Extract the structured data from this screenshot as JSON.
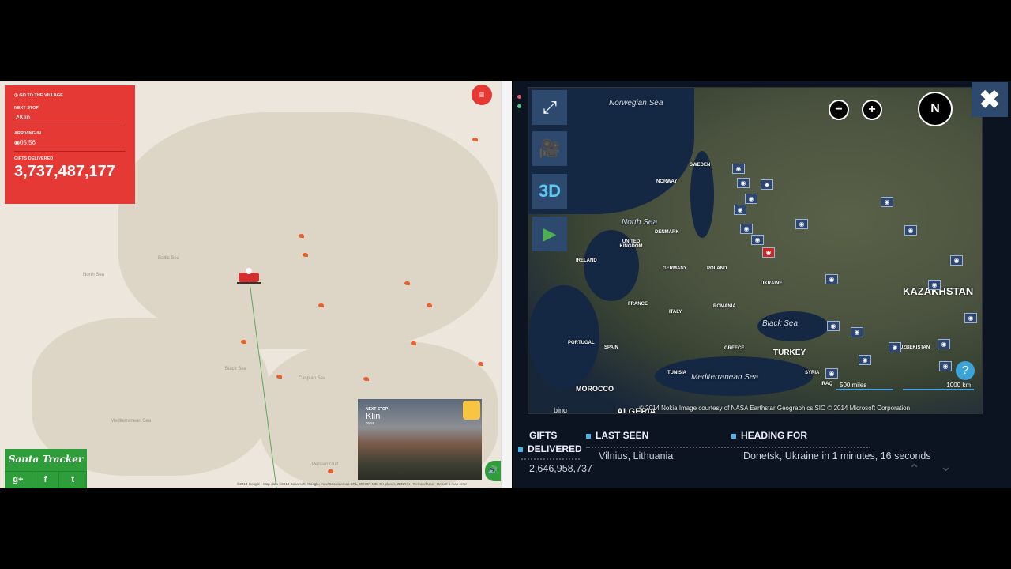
{
  "left_tracker": {
    "go_to_village": "GO TO THE VILLAGE",
    "next_stop_label": "NEXT STOP",
    "next_stop": "Klin",
    "arriving_label": "ARRIVING IN",
    "arriving_in": "05:56",
    "gifts_label": "GIFTS DELIVERED",
    "gifts_delivered": "3,737,487,177",
    "menu_icon": "≡",
    "map_labels": [
      "Baltic Sea",
      "North Sea",
      "Black Sea",
      "Caspian Sea",
      "Mediterranean Sea",
      "Persian Gulf"
    ],
    "brand": "Santa Tracker",
    "social": [
      "g+",
      "f",
      "t"
    ],
    "card": {
      "label": "NEXT STOP",
      "city": "Klin",
      "time": "05:55"
    },
    "attribution": "©2014 Google - Map data ©2014 Basarsoft, Google, Inav/Geosistemas SRL, ORION-ME, SK planet, ZENRIN",
    "terms": "Terms of Use",
    "report": "Report a map error",
    "accent_color": "#e53935",
    "green_color": "#2e9e3a"
  },
  "right_tracker": {
    "sea_labels": [
      "Norwegian Sea",
      "North Sea",
      "Black Sea",
      "Mediterranean Sea"
    ],
    "country_labels": [
      "SWEDEN",
      "NORWAY",
      "DENMARK",
      "UNITED KINGDOM",
      "IRELAND",
      "GERMANY",
      "POLAND",
      "UKRAINE",
      "FRANCE",
      "ROMANIA",
      "ITALY",
      "SPAIN",
      "PORTUGAL",
      "GREECE",
      "TURKEY",
      "TUNISIA",
      "SYRIA",
      "MOROCCO",
      "ALGERIA",
      "KAZAKHSTAN",
      "UZBEKISTAN",
      "IRAQ"
    ],
    "tool_3d": "3D",
    "compass": "N",
    "zoom_out": "−",
    "zoom_in": "+",
    "help": "?",
    "close": "✖",
    "scale_miles": "500 miles",
    "scale_km": "1000 km",
    "bing": "bing",
    "attribution": "© 2014 Nokia   Image courtesy of NASA   Earthstar Geographics SIO   © 2014 Microsoft Corporation",
    "gifts_label_1": "GIFTS",
    "gifts_label_2": "DELIVERED",
    "gifts_delivered": "2,646,958,737",
    "last_seen_label": "LAST SEEN",
    "last_seen": "Vilnius, Lithuania",
    "heading_label": "HEADING FOR",
    "heading_for": "Donetsk, Ukraine in 1 minutes, 16 seconds",
    "accent_color": "#4ab0e8"
  }
}
